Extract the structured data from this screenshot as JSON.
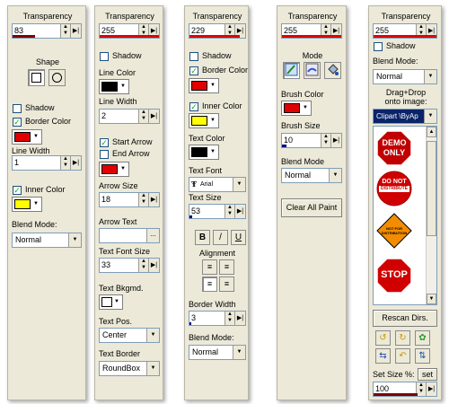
{
  "panel1": {
    "transparency_label": "Transparency",
    "transparency_value": "83",
    "transparency_level": 0.33,
    "shape_label": "Shape",
    "shadow_label": "Shadow",
    "border_color_label": "Border Color",
    "line_width_label": "Line Width",
    "line_width_value": "1",
    "inner_color_label": "Inner Color",
    "blend_mode_label": "Blend Mode:",
    "blend_mode_value": "Normal"
  },
  "panel2": {
    "transparency_label": "Transparency",
    "transparency_value": "255",
    "shadow_label": "Shadow",
    "line_color_label": "Line Color",
    "line_width_label": "Line Width",
    "line_width_value": "2",
    "start_arrow_label": "Start Arrow",
    "end_arrow_label": "End Arrow",
    "arrow_size_label": "Arrow Size",
    "arrow_size_value": "18",
    "arrow_text_label": "Arrow Text",
    "arrow_text_button": "...",
    "text_font_size_label": "Text Font Size",
    "text_font_size_value": "33",
    "text_bkgmd_label": "Text Bkgmd.",
    "text_pos_label": "Text Pos.",
    "text_pos_value": "Center",
    "text_border_label": "Text Border",
    "text_border_value": "RoundBox"
  },
  "panel3": {
    "transparency_label": "Transparency",
    "transparency_value": "229",
    "shadow_label": "Shadow",
    "border_color_label": "Border Color",
    "inner_color_label": "Inner Color",
    "text_color_label": "Text Color",
    "text_font_label": "Text Font",
    "text_font_value": "Arial",
    "text_size_label": "Text Size",
    "text_size_value": "53",
    "bold_label": "B",
    "italic_label": "/",
    "underline_label": "U",
    "alignment_label": "Alignment",
    "border_width_label": "Border Width",
    "border_width_value": "3",
    "blend_mode_label": "Blend Mode:",
    "blend_mode_value": "Normal"
  },
  "panel4": {
    "transparency_label": "Transparency",
    "transparency_value": "255",
    "mode_label": "Mode",
    "brush_color_label": "Brush Color",
    "brush_size_label": "Brush Size",
    "brush_size_value": "10",
    "blend_mode_label": "Blend Mode",
    "blend_mode_value": "Normal",
    "clear_button": "Clear All Paint"
  },
  "panel5": {
    "transparency_label": "Transparency",
    "transparency_value": "255",
    "shadow_label": "Shadow",
    "blend_mode_label": "Blend Mode:",
    "blend_mode_value": "Normal",
    "drag_drop_label_1": "Drag+Drop",
    "drag_drop_label_2": "onto image:",
    "folder_value": "Clipart \\ByAp",
    "sign_demo_1": "DEMO",
    "sign_demo_2": "ONLY",
    "sign_donot_1": "DO NOT",
    "sign_donot_2": "DISTRIBUTE",
    "sign_diamond_1": "NOT FOR",
    "sign_diamond_2": "DISTRIBUTION",
    "sign_stop": "STOP",
    "rescan_button": "Rescan Dirs.",
    "set_size_label": "Set Size %:",
    "set_button": "set",
    "size_value": "100"
  },
  "colors": {
    "panel_bg": "#ece9d8",
    "red": "#e00000",
    "yellow": "#ffff00",
    "black": "#000000",
    "white": "#ffffff",
    "bar_dark_red": "#800000",
    "bar_navy": "#000080",
    "selection_blue": "#0a246a"
  }
}
